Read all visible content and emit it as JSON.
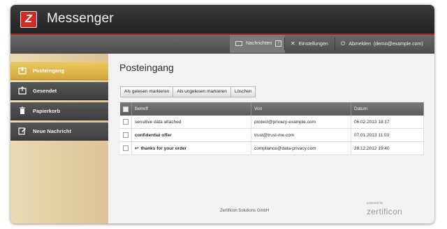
{
  "app": {
    "logo_letter": "Z",
    "title": "Messenger"
  },
  "topnav": {
    "messages": {
      "label": "Nachrichten",
      "badge": "7"
    },
    "settings": {
      "label": "Einstellungen"
    },
    "logout": {
      "label": "Abmelden",
      "account": "(demo@example.com)"
    }
  },
  "sidebar": {
    "items": [
      {
        "label": "Posteingang",
        "icon": "inbox-icon",
        "active": true
      },
      {
        "label": "Gesendet",
        "icon": "sent-icon",
        "active": false
      },
      {
        "label": "Papierkorb",
        "icon": "trash-icon",
        "active": false
      },
      {
        "label": "Neue Nachricht",
        "icon": "compose-icon",
        "active": false
      }
    ]
  },
  "main": {
    "title": "Posteingang",
    "toolbar": {
      "mark_read": "Als gelesen markieren",
      "mark_unread": "Als ungelesen markieren",
      "delete": "Löschen"
    },
    "table": {
      "columns": [
        "Betreff",
        "Von",
        "Datum"
      ],
      "rows": [
        {
          "subject": "sensitive data attached",
          "from": "protect@privacy-example.com",
          "date": "06.02.2013 18:17",
          "unread": false,
          "replied": false
        },
        {
          "subject": "confidential offer",
          "from": "trust@trust-me.com",
          "date": "07.01.2013 11:03",
          "unread": true,
          "replied": false
        },
        {
          "subject": "thanks for your order",
          "from": "compliance@data-privacy.com",
          "date": "28.12.2012 19:40",
          "unread": true,
          "replied": true
        }
      ]
    }
  },
  "footer": {
    "company": "Zertificon Solutions GmbH",
    "powered_by": "powered by",
    "brand": "zertificon"
  },
  "colors": {
    "accent_red": "#cf2a24",
    "active_gold": "#d7ab3d",
    "header_dark": "#2b2b2b"
  }
}
